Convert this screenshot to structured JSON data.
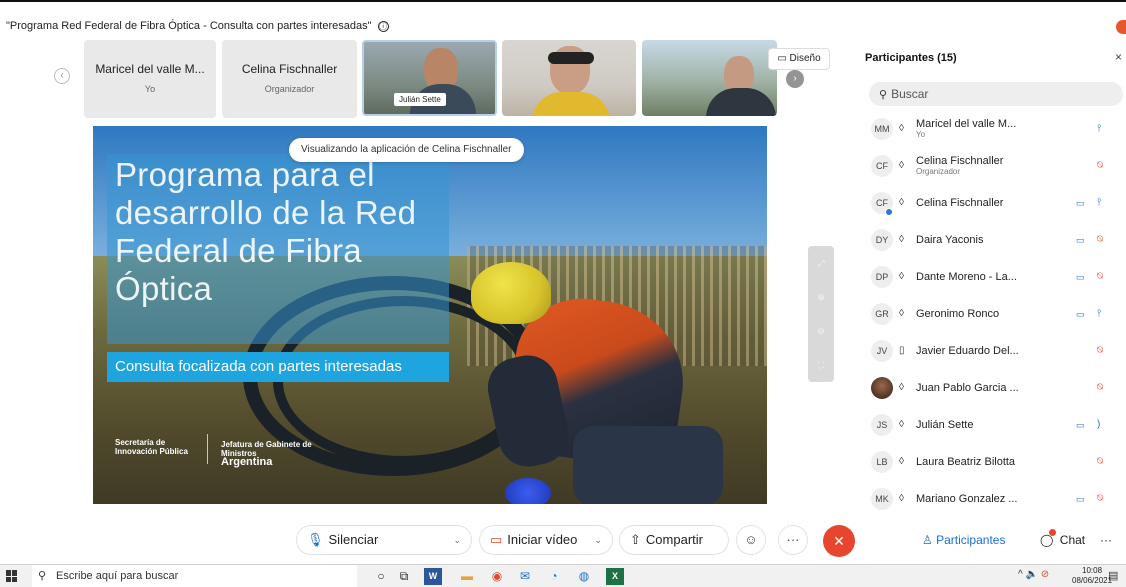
{
  "window": {
    "title": "\"Programa Red Federal de Fibra Óptica - Consulta con partes interesadas\"",
    "info_icon": "ⓘ"
  },
  "strip": {
    "tiles": [
      {
        "name": "Maricel del valle M...",
        "role": "Yo"
      },
      {
        "name": "Celina Fischnaller",
        "role": "Organizador"
      }
    ],
    "video_label": "Julián Sette",
    "layout_label": "Diseño"
  },
  "slide": {
    "title": "Programa para el desarrollo de la Red Federal de Fibra Óptica",
    "subtitle": "Consulta focalizada con partes interesadas",
    "logo_left": "Secretaría de Innovación Pública",
    "logo_right_1": "Jefatura de Gabinete de Ministros",
    "logo_right_2": "Argentina"
  },
  "viewing_notice": "Visualizando la aplicación de Celina Fischnaller",
  "participants": {
    "title": "Participantes (15)",
    "close": "×",
    "search_placeholder": "Buscar",
    "people": [
      {
        "initials": "MM",
        "name": "Maricel del valle M...",
        "role": "Yo",
        "mic": "on",
        "cam": false
      },
      {
        "initials": "CF",
        "name": "Celina Fischnaller",
        "role": "Organizador",
        "mic": "off",
        "cam": false
      },
      {
        "initials": "CF",
        "name": "Celina Fischnaller",
        "role": "",
        "mic": "on",
        "cam": true,
        "status": true
      },
      {
        "initials": "DY",
        "name": "Daira Yaconis",
        "role": "",
        "mic": "off",
        "cam": true
      },
      {
        "initials": "DP",
        "name": "Dante Moreno - La...",
        "role": "",
        "mic": "off",
        "cam": true
      },
      {
        "initials": "GR",
        "name": "Geronimo Ronco",
        "role": "",
        "mic": "on",
        "cam": true
      },
      {
        "initials": "JV",
        "name": "Javier Eduardo Del...",
        "role": "",
        "mic": "off",
        "cam": false,
        "device": "phone"
      },
      {
        "initials": "",
        "name": "Juan Pablo Garcia ...",
        "role": "",
        "mic": "off",
        "cam": false,
        "photo": true
      },
      {
        "initials": "JS",
        "name": "Julián Sette",
        "role": "",
        "mic": "speaking",
        "cam": true
      },
      {
        "initials": "LB",
        "name": "Laura Beatriz Bilotta",
        "role": "",
        "mic": "off",
        "cam": false
      },
      {
        "initials": "MK",
        "name": "Mariano Gonzalez ...",
        "role": "",
        "mic": "off",
        "cam": true
      }
    ]
  },
  "controls": {
    "mute": "Silenciar",
    "video": "Iniciar vídeo",
    "share": "Compartir",
    "participants": "Participantes",
    "chat": "Chat",
    "more": "···"
  },
  "taskbar": {
    "search_placeholder": "Escribe aquí para buscar",
    "time": "10:08",
    "date": "08/06/2021"
  },
  "colors": {
    "accent": "#1a6ecf",
    "end_call": "#e8452f",
    "slide_sub_bg": "#1ea4df",
    "mic_off": "#e0442f"
  }
}
